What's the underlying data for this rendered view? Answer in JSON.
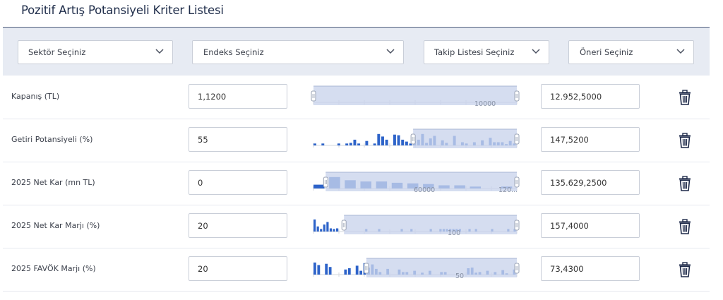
{
  "title": "Pozitif Artış Potansiyeli Kriter Listesi",
  "filters": {
    "sector": "Sektör Seçiniz",
    "index": "Endeks Seçiniz",
    "watchlist": "Takip Listesi Seçiniz",
    "recommendation": "Öneri Seçiniz"
  },
  "colors": {
    "accent": "#2d63c9",
    "range_fill": "#c9d4ec",
    "filter_bar_bg": "#e7ebf3",
    "trash": "#1e2a4a"
  },
  "rows": [
    {
      "label": "Kapanış (TL)",
      "min": "1,1200",
      "max": "12.952,5000",
      "range": [
        0.0,
        1.0
      ],
      "tick_label": "10000",
      "histogram": []
    },
    {
      "label": "Getiri Potansiyeli (%)",
      "min": "55",
      "max": "147,5200",
      "range": [
        0.49,
        1.0
      ],
      "tick_label": "",
      "histogram": [
        0.15,
        0,
        0.15,
        0,
        0,
        0,
        0.15,
        0,
        0.15,
        0.2,
        0.45,
        0.15,
        0,
        0.35,
        0,
        0.15,
        0.9,
        0.7,
        0.45,
        0,
        0.85,
        0.8,
        0.45,
        0.3,
        0.15,
        0.35,
        0.45,
        0.9,
        0.2,
        0.55,
        0.75,
        0,
        0.4,
        0.2,
        0,
        0.75,
        0,
        0.25,
        0.15,
        0,
        0.25,
        0,
        0.4,
        0,
        0.6,
        0.25,
        0.25,
        0.25,
        0.1,
        0.35,
        0.15
      ]
    },
    {
      "label": "2025 Net Kar (mn TL)",
      "min": "0",
      "max": "135.629,2500",
      "range": [
        0.06,
        1.0
      ],
      "tick_label": "60000",
      "tick_label_2": "120...",
      "histogram": [
        0.3,
        0.9,
        0.65,
        0.55,
        0.55,
        0.45,
        0.4,
        0.35,
        0.25,
        0.25,
        0.15,
        0,
        0.15
      ]
    },
    {
      "label": "2025 Net Kar Marjı (%)",
      "min": "20",
      "max": "157,4000",
      "range": [
        0.15,
        1.0
      ],
      "tick_label": "100",
      "histogram": [
        0.95,
        0.4,
        0.2,
        0.55,
        0.75,
        0.25,
        0.2,
        0.25,
        0,
        0,
        0,
        0,
        0,
        0,
        0,
        0,
        0.2,
        0,
        0,
        0,
        0.2,
        0,
        0,
        0,
        0,
        0,
        0,
        0.2,
        0,
        0,
        0.2,
        0,
        0,
        0,
        0,
        0,
        0.2,
        0,
        0,
        0.2,
        0.2,
        0.2,
        0.2,
        0.2,
        0.2,
        0.2,
        0,
        0,
        0.2,
        0,
        0.2,
        0,
        0,
        0,
        0,
        0.2,
        0,
        0,
        0,
        0,
        0.2,
        0,
        0.2
      ]
    },
    {
      "label": "2025 FAVÖK Marjı (%)",
      "min": "20",
      "max": "73,4300",
      "range": [
        0.26,
        1.0
      ],
      "tick_label": "50",
      "histogram": [
        0.95,
        0.75,
        0,
        0.85,
        0.6,
        0,
        0,
        0,
        0.4,
        0.5,
        0,
        0.7,
        0.3,
        0.9,
        0.55,
        0.8,
        0.45,
        0.2,
        0,
        0.45,
        0,
        0,
        0.4,
        0.2,
        0.2,
        0,
        0.3,
        0,
        0.15,
        0,
        0.3,
        0,
        0,
        0.2,
        0.2,
        0,
        0,
        0,
        0,
        0,
        0.5,
        0.55,
        0.15,
        0.2,
        0,
        0.3,
        0,
        0.2,
        0,
        0.35,
        0.1,
        0,
        0.4
      ]
    }
  ]
}
